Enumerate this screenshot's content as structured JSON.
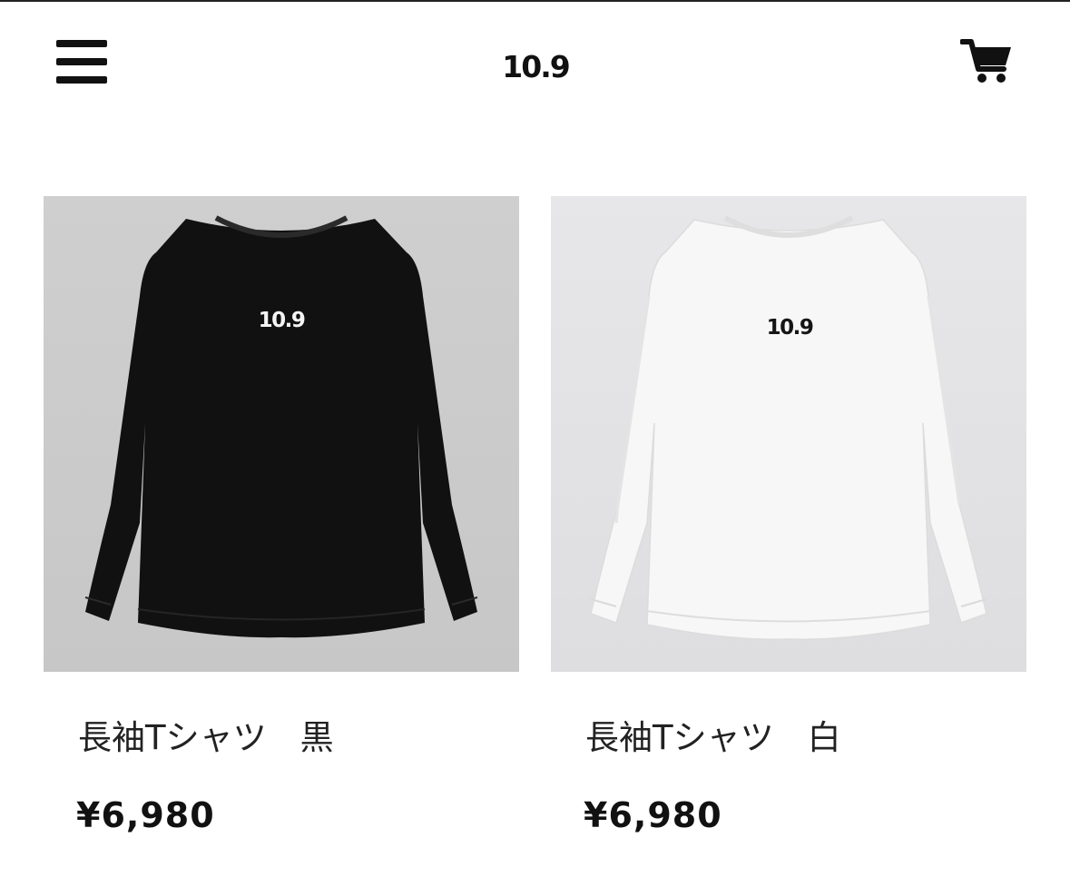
{
  "header": {
    "logo_text": "10.9",
    "menu_icon": "hamburger-menu-icon",
    "cart_icon": "shopping-cart-icon"
  },
  "colors": {
    "text": "#111111",
    "black_shirt": "#111111",
    "white_shirt": "#f7f7f7",
    "image_bg_1": "#cbcbcb",
    "image_bg_2": "#e2e2e4"
  },
  "products": [
    {
      "name": "長袖Tシャツ　黒",
      "price": "¥6,980",
      "shirt_logo": "10.9",
      "shirt_color": "black"
    },
    {
      "name": "長袖Tシャツ　白",
      "price": "¥6,980",
      "shirt_logo": "10.9",
      "shirt_color": "white"
    }
  ]
}
